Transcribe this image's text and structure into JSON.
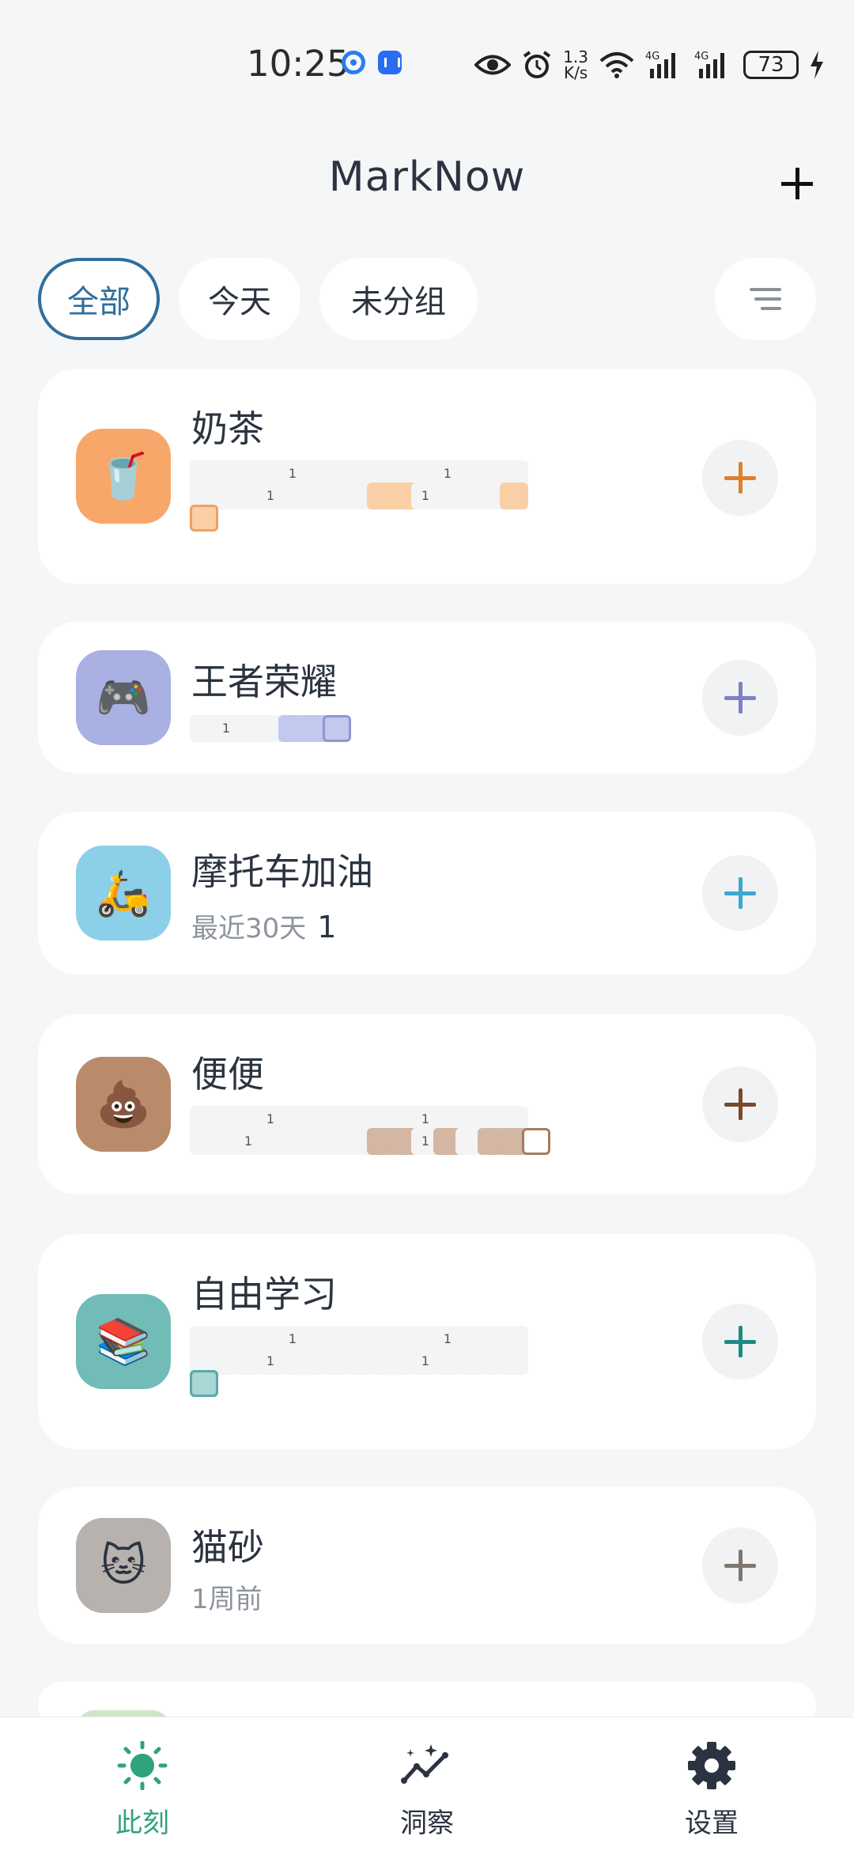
{
  "status_bar": {
    "time": "10:25",
    "speed_top": "1.3",
    "speed_bottom": "K/s",
    "battery": "73",
    "net1": "4G",
    "net2": "4G"
  },
  "header": {
    "title": "MarkNow"
  },
  "filters": [
    {
      "label": "全部",
      "active": true
    },
    {
      "label": "今天",
      "active": false
    },
    {
      "label": "未分组",
      "active": false
    }
  ],
  "items": [
    {
      "name": "奶茶",
      "icon": "🥤",
      "icon_bg": "#f8a76a",
      "accent": "#e0802e",
      "cell_color": "#fbcfa6",
      "cell_border": "#f0a060"
    },
    {
      "name": "王者荣耀",
      "icon": "🎮",
      "icon_bg": "#a9b0e2",
      "accent": "#7b82c4",
      "cell_color": "#c3c8ee",
      "cell_border": "#8f96d2"
    },
    {
      "name": "摩托车加油",
      "icon": "🛵",
      "icon_bg": "#8ccfe8",
      "accent": "#3aa8cf",
      "subtitle": "最近30天",
      "count": "1"
    },
    {
      "name": "便便",
      "icon": "💩",
      "icon_bg": "#b98b6a",
      "accent": "#7a4a2a",
      "cell_color": "#d3b7a2",
      "cell_border": "#a37c5f"
    },
    {
      "name": "自由学习",
      "icon": "📚",
      "icon_bg": "#72bcb8",
      "accent": "#1f8a84",
      "cell_color": "#a8d7d5",
      "cell_border": "#5aaaa6"
    },
    {
      "name": "猫砂",
      "icon": "🐱",
      "icon_bg": "#b7b2ad",
      "accent": "#7d776f",
      "subtitle": "1周前"
    }
  ],
  "heatmap_marks": {
    "number_label": "1"
  },
  "bottom_nav": [
    {
      "label": "此刻",
      "active": true
    },
    {
      "label": "洞察",
      "active": false
    },
    {
      "label": "设置",
      "active": false
    }
  ],
  "colors": {
    "active": "#2fa37a",
    "chip_active": "#2f6e9c"
  }
}
